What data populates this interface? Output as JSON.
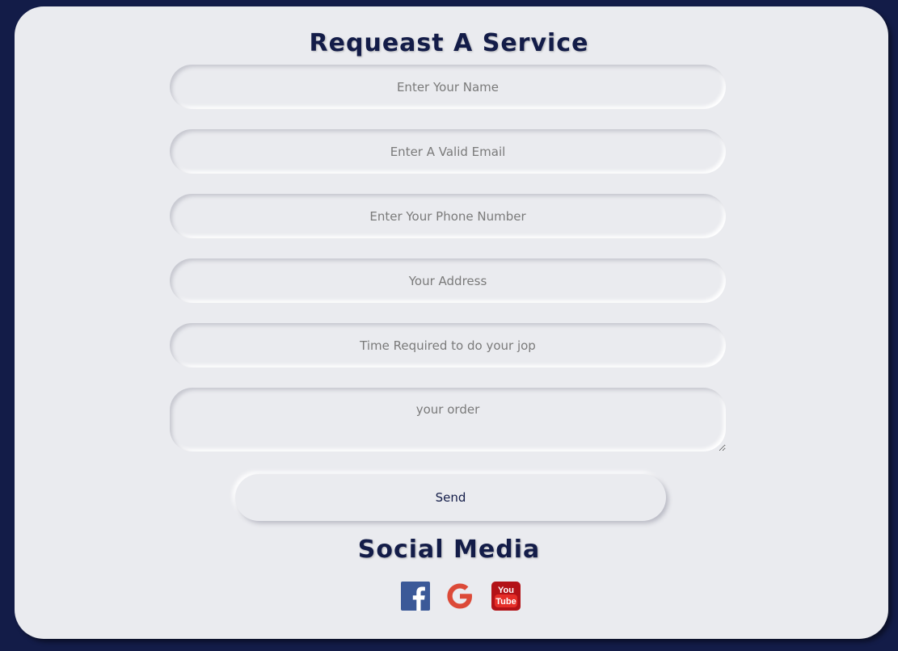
{
  "form": {
    "title": "Requeast A Service",
    "name_placeholder": "Enter Your Name",
    "email_placeholder": "Enter A Valid Email",
    "phone_placeholder": "Enter Your Phone Number",
    "address_placeholder": "Your Address",
    "time_placeholder": "Time Required to do your jop",
    "order_placeholder": "your order",
    "send_label": "Send"
  },
  "social": {
    "title": "Social Media",
    "items": [
      {
        "icon": "facebook-icon",
        "color": "#3b5998"
      },
      {
        "icon": "google-icon",
        "color": "#dc4a38"
      },
      {
        "icon": "youtube-icon",
        "color": "#b31217",
        "label_top": "You",
        "label_bottom": "Tube"
      }
    ]
  },
  "colors": {
    "background": "#131c48",
    "card": "#eaebef",
    "accent": "#131c48"
  }
}
